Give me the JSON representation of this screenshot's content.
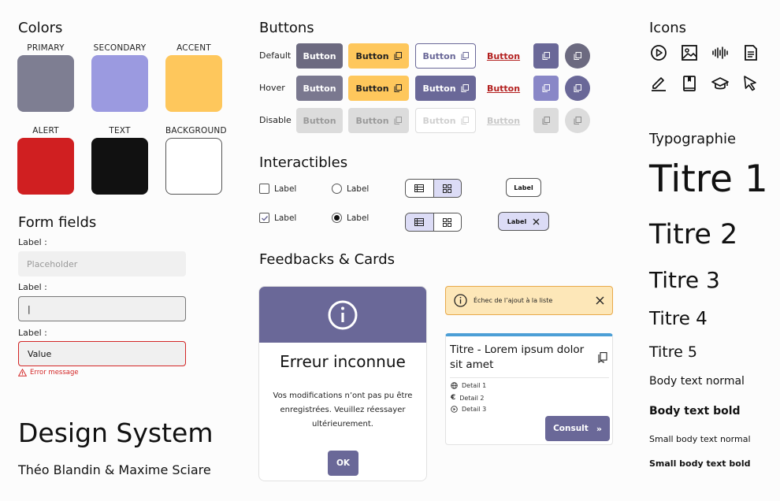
{
  "colors": {
    "title": "Colors",
    "swatches": [
      {
        "label": "PRIMARY",
        "hex": "#7e7e92"
      },
      {
        "label": "SECONDARY",
        "hex": "#9b9ae0"
      },
      {
        "label": "ACCENT",
        "hex": "#fec75c"
      },
      {
        "label": "ALERT",
        "hex": "#d01f21"
      },
      {
        "label": "TEXT",
        "hex": "#111111"
      },
      {
        "label": "BACKGROUND",
        "hex": "#ffffff"
      }
    ]
  },
  "form": {
    "title": "Form fields",
    "fields": [
      {
        "label": "Label :",
        "placeholder": "Placeholder"
      },
      {
        "label": "Label :",
        "value": "|"
      },
      {
        "label": "Label :",
        "value": "Value",
        "error": "Error message"
      }
    ]
  },
  "buttons": {
    "title": "Buttons",
    "states": [
      "Default",
      "Hover",
      "Disable"
    ],
    "label": "Button"
  },
  "interactibles": {
    "title": "Interactibles",
    "checkbox_label": "Label",
    "radio_label": "Label",
    "tag_label": "Label",
    "chip_label": "Label"
  },
  "feedbacks": {
    "title": "Feedbacks & Cards",
    "error_card": {
      "title": "Erreur inconnue",
      "body": "Vos modifications n’ont pas pu être enregistrées. Veuillez réessayer ultérieurement.",
      "ok": "OK"
    },
    "toast": {
      "text": "Échec de l’ajout à la liste"
    },
    "info_card": {
      "title": "Titre - Lorem ipsum dolor sit amet",
      "details": [
        "Detail 1",
        "Detail 2",
        "Detail 3"
      ],
      "cta": "Consult"
    }
  },
  "footer": {
    "title": "Design System",
    "authors": "Théo Blandin & Maxime Sciare"
  },
  "icons": {
    "title": "Icons",
    "list": [
      "play-icon",
      "image-icon",
      "audio-wave-icon",
      "document-icon",
      "pencil-icon",
      "book-icon",
      "graduation-cap-icon",
      "cursor-icon"
    ]
  },
  "typography": {
    "title": "Typographie",
    "t1": "Titre 1",
    "t2": "Titre 2",
    "t3": "Titre 3",
    "t4": "Titre 4",
    "t5": "Titre 5",
    "body": "Body text normal",
    "body_bold": "Body text bold",
    "small": "Small body text normal",
    "small_bold": "Small body text bold"
  },
  "palette": {
    "primary_dark": "#6a6898",
    "button_default": "#6c6a80",
    "button_hover": "#7a788f",
    "link_red": "#b3201f",
    "disabled_bg": "#dcdcdc",
    "disabled_text": "#a8a8a8",
    "toggle_selected": "#dcdcf6"
  }
}
